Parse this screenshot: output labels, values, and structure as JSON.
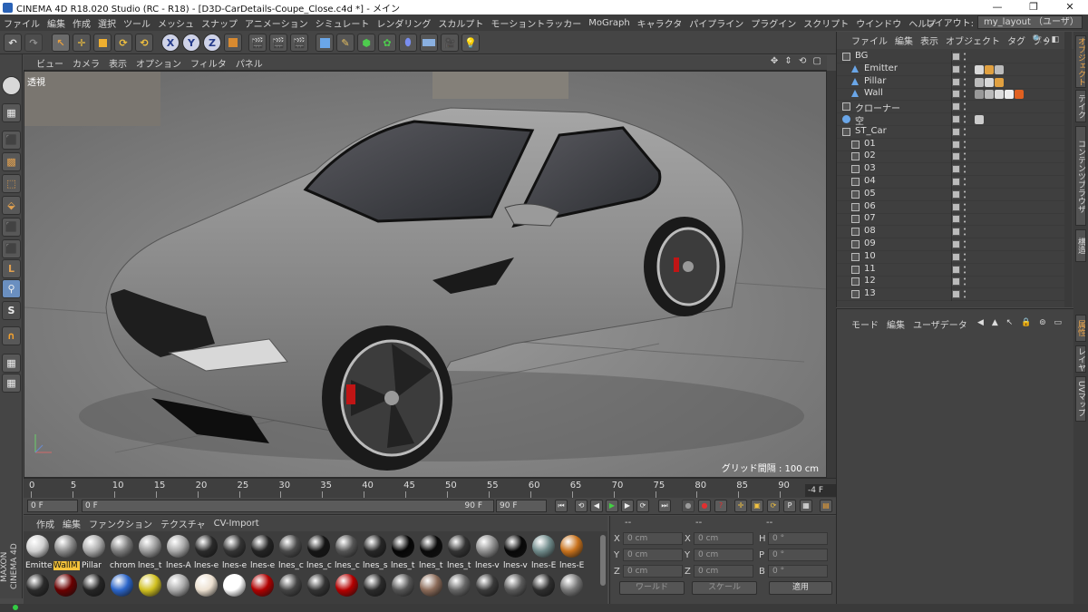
{
  "window": {
    "title": "CINEMA 4D R18.020 Studio (RC - R18) - [D3D-CarDetails-Coupe_Close.c4d *] - メイン",
    "minimize": "—",
    "maximize": "❐",
    "close": "✕"
  },
  "menubar": [
    "ファイル",
    "編集",
    "作成",
    "選択",
    "ツール",
    "メッシュ",
    "スナップ",
    "アニメーション",
    "シミュレート",
    "レンダリング",
    "スカルプト",
    "モーショントラッカー",
    "MoGraph",
    "キャラクタ",
    "パイプライン",
    "プラグイン",
    "スクリプト",
    "ウインドウ",
    "ヘルプ"
  ],
  "layout": {
    "label": "レイアウト:",
    "value": "my_layout （ユーザ）"
  },
  "toolbar": {
    "undo": "↶",
    "redo": "↷",
    "move": "✛",
    "rotate": "⟳",
    "axis_x": "X",
    "axis_y": "Y",
    "axis_z": "Z"
  },
  "viewport": {
    "menus": [
      "ビュー",
      "カメラ",
      "表示",
      "オプション",
      "フィルタ",
      "パネル"
    ],
    "view_name": "透視",
    "grid_label": "グリッド間隔 : 100 cm",
    "nav_icons": "✥ ⇕ ⟲ ▢"
  },
  "timeline": {
    "ticks": [
      "0",
      "5",
      "10",
      "15",
      "20",
      "25",
      "30",
      "35",
      "40",
      "45",
      "50",
      "55",
      "60",
      "65",
      "70",
      "75",
      "80",
      "85",
      "90"
    ],
    "current_frame": "-4 F"
  },
  "transport": {
    "start_field": "0 F",
    "slider_start": "0 F",
    "slider_end": "90 F",
    "end_field": "90 F"
  },
  "materials": {
    "menu": [
      "作成",
      "編集",
      "ファンクション",
      "テクスチャ",
      "CV-Import"
    ],
    "row1": [
      {
        "name": "Emitte",
        "color": "#cfcfcf"
      },
      {
        "name": "WallM",
        "color": "#8a8a8a",
        "active": true
      },
      {
        "name": "Pillar",
        "color": "#aaaaaa"
      },
      {
        "name": "chrom",
        "color": "#7c7c7c"
      },
      {
        "name": "lnes_t",
        "color": "#9a9a9a"
      },
      {
        "name": "lnes-A",
        "color": "#a8a8a8"
      },
      {
        "name": "lnes-e",
        "color": "#2a2a2a"
      },
      {
        "name": "lnes-e",
        "color": "#343434"
      },
      {
        "name": "lnes-e",
        "color": "#232323"
      },
      {
        "name": "lnes_c",
        "color": "#4a4a4a"
      },
      {
        "name": "lnes_c",
        "color": "#151515"
      },
      {
        "name": "lnes_c",
        "color": "#555555"
      },
      {
        "name": "lnes_s",
        "color": "#262626"
      },
      {
        "name": "lnes_t",
        "color": "#050505"
      },
      {
        "name": "lnes_t",
        "color": "#0a0a0a"
      },
      {
        "name": "lnes_t",
        "color": "#333333"
      },
      {
        "name": "lnes-v",
        "color": "#8f8f8f"
      },
      {
        "name": "lnes-v",
        "color": "#080808"
      },
      {
        "name": "lnes-E",
        "color": "#6f8a8a"
      },
      {
        "name": "lnes-E",
        "color": "#c8721c"
      }
    ],
    "row2": [
      "#2b2b2b",
      "#6a0000",
      "#252525",
      "#2a64c8",
      "#d0c020",
      "#aaaaaa",
      "#ece0d0",
      "#ffffff",
      "#b00000",
      "#444444",
      "#333333",
      "#b50000",
      "#2a2a2a",
      "#555555",
      "#8a6a58",
      "#666666",
      "#3a3a3a",
      "#5a5a5a",
      "#2e2e2e",
      "#777777"
    ]
  },
  "coordinates": {
    "headers": [
      "--",
      "--",
      "--"
    ],
    "rows": [
      {
        "a": "X",
        "av": "0 cm",
        "b": "X",
        "bv": "0 cm",
        "c": "H",
        "cv": "0 °"
      },
      {
        "a": "Y",
        "av": "0 cm",
        "b": "Y",
        "bv": "0 cm",
        "c": "P",
        "cv": "0 °"
      },
      {
        "a": "Z",
        "av": "0 cm",
        "b": "Z",
        "bv": "0 cm",
        "c": "B",
        "cv": "0 °"
      }
    ],
    "world": "ワールド",
    "scale": "スケール",
    "apply": "適用"
  },
  "objects": {
    "menu": [
      "ファイル",
      "編集",
      "表示",
      "オブジェクト",
      "タグ",
      "ブッ"
    ],
    "items": [
      {
        "name": "BG",
        "indent": 0,
        "type": "null"
      },
      {
        "name": "Emitter",
        "indent": 1,
        "type": "geo"
      },
      {
        "name": "Pillar",
        "indent": 1,
        "type": "geo"
      },
      {
        "name": "Wall",
        "indent": 1,
        "type": "geo"
      },
      {
        "name": "クローナー",
        "indent": 0,
        "type": "null"
      },
      {
        "name": "空",
        "indent": 0,
        "type": "sky"
      },
      {
        "name": "ST_Car",
        "indent": 0,
        "type": "null"
      },
      {
        "name": "01",
        "indent": 1,
        "type": "null"
      },
      {
        "name": "02",
        "indent": 1,
        "type": "null"
      },
      {
        "name": "03",
        "indent": 1,
        "type": "null"
      },
      {
        "name": "04",
        "indent": 1,
        "type": "null"
      },
      {
        "name": "05",
        "indent": 1,
        "type": "null"
      },
      {
        "name": "06",
        "indent": 1,
        "type": "null"
      },
      {
        "name": "07",
        "indent": 1,
        "type": "null"
      },
      {
        "name": "08",
        "indent": 1,
        "type": "null"
      },
      {
        "name": "09",
        "indent": 1,
        "type": "null"
      },
      {
        "name": "10",
        "indent": 1,
        "type": "null"
      },
      {
        "name": "11",
        "indent": 1,
        "type": "null"
      },
      {
        "name": "12",
        "indent": 1,
        "type": "null"
      },
      {
        "name": "13",
        "indent": 1,
        "type": "null"
      }
    ]
  },
  "attributes": {
    "menu": [
      "モード",
      "編集",
      "ユーザデータ"
    ],
    "nav": "◀ ▲ ↖ 🔒 ⊚ ▭"
  },
  "right_tabs_top": [
    "オブジェクト",
    "テイク",
    "コンテンツブラウザ",
    "構造"
  ],
  "right_tabs_bottom": [
    "属性",
    "レイヤ",
    "UVマップ"
  ],
  "brand": "MAXON CINEMA 4D"
}
